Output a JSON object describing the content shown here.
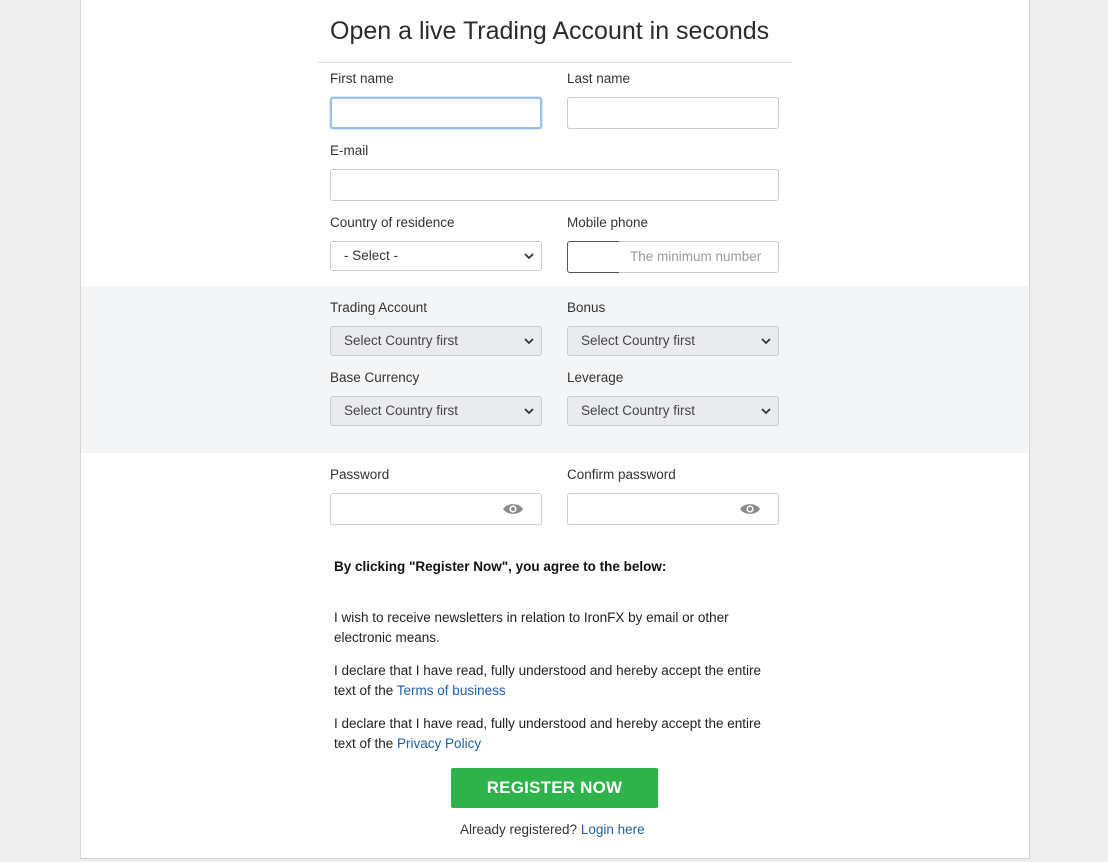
{
  "form": {
    "title": "Open a live Trading Account in seconds",
    "first_name": {
      "label": "First name",
      "value": ""
    },
    "last_name": {
      "label": "Last name",
      "value": ""
    },
    "email": {
      "label": "E-mail",
      "value": ""
    },
    "country": {
      "label": "Country of residence",
      "selected": "- Select -"
    },
    "mobile": {
      "label": "Mobile phone",
      "code": "",
      "placeholder": "The minimum number"
    },
    "trading_account": {
      "label": "Trading Account",
      "selected": "Select Country first"
    },
    "bonus": {
      "label": "Bonus",
      "selected": "Select Country first"
    },
    "base_currency": {
      "label": "Base Currency",
      "selected": "Select Country first"
    },
    "leverage": {
      "label": "Leverage",
      "selected": "Select Country first"
    },
    "password": {
      "label": "Password",
      "value": ""
    },
    "confirm_password": {
      "label": "Confirm password",
      "value": ""
    }
  },
  "agreement": {
    "heading": "By clicking \"Register Now\", you agree to the below:",
    "newsletter": "I wish to receive newsletters in relation to IronFX by email or other electronic means.",
    "terms_prefix": "I declare that I have read, fully understood and hereby accept the entire text of the ",
    "terms_link": "Terms of business",
    "privacy_prefix": "I declare that I have read, fully understood and hereby accept the entire text of the ",
    "privacy_link": "Privacy Policy"
  },
  "actions": {
    "register_label": "REGISTER NOW",
    "already_text": "Already registered?",
    "login_link": "Login here"
  },
  "colors": {
    "accent_green": "#2db34a",
    "link_blue": "#1f5fa8",
    "band_grey": "#f4f5f6"
  },
  "icons": {
    "select_arrow": "chevron-down-icon",
    "password_toggle": "eye-icon"
  }
}
